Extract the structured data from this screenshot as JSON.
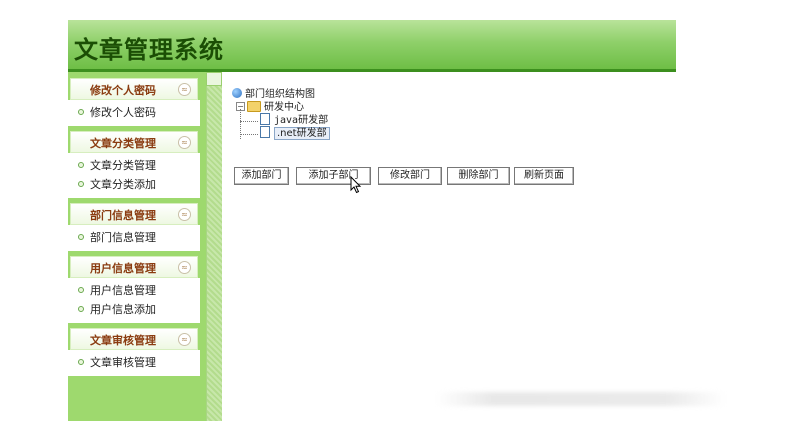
{
  "app": {
    "title": "文章管理系统"
  },
  "sidebar": {
    "sections": [
      {
        "title": "修改个人密码",
        "items": [
          "修改个人密码"
        ]
      },
      {
        "title": "文章分类管理",
        "items": [
          "文章分类管理",
          "文章分类添加"
        ]
      },
      {
        "title": "部门信息管理",
        "items": [
          "部门信息管理"
        ]
      },
      {
        "title": "用户信息管理",
        "items": [
          "用户信息管理",
          "用户信息添加"
        ]
      },
      {
        "title": "文章审核管理",
        "items": [
          "文章审核管理"
        ]
      }
    ],
    "collapse_glyph": "≈"
  },
  "tree": {
    "root": "部门组织结构图",
    "center": "研发中心",
    "children": [
      "java研发部",
      ".net研发部"
    ],
    "selected": ".net研发部"
  },
  "toolbar": {
    "buttons": [
      "添加部门",
      "添加子部门",
      "修改部门",
      "删除部门",
      "刷新页面"
    ]
  }
}
